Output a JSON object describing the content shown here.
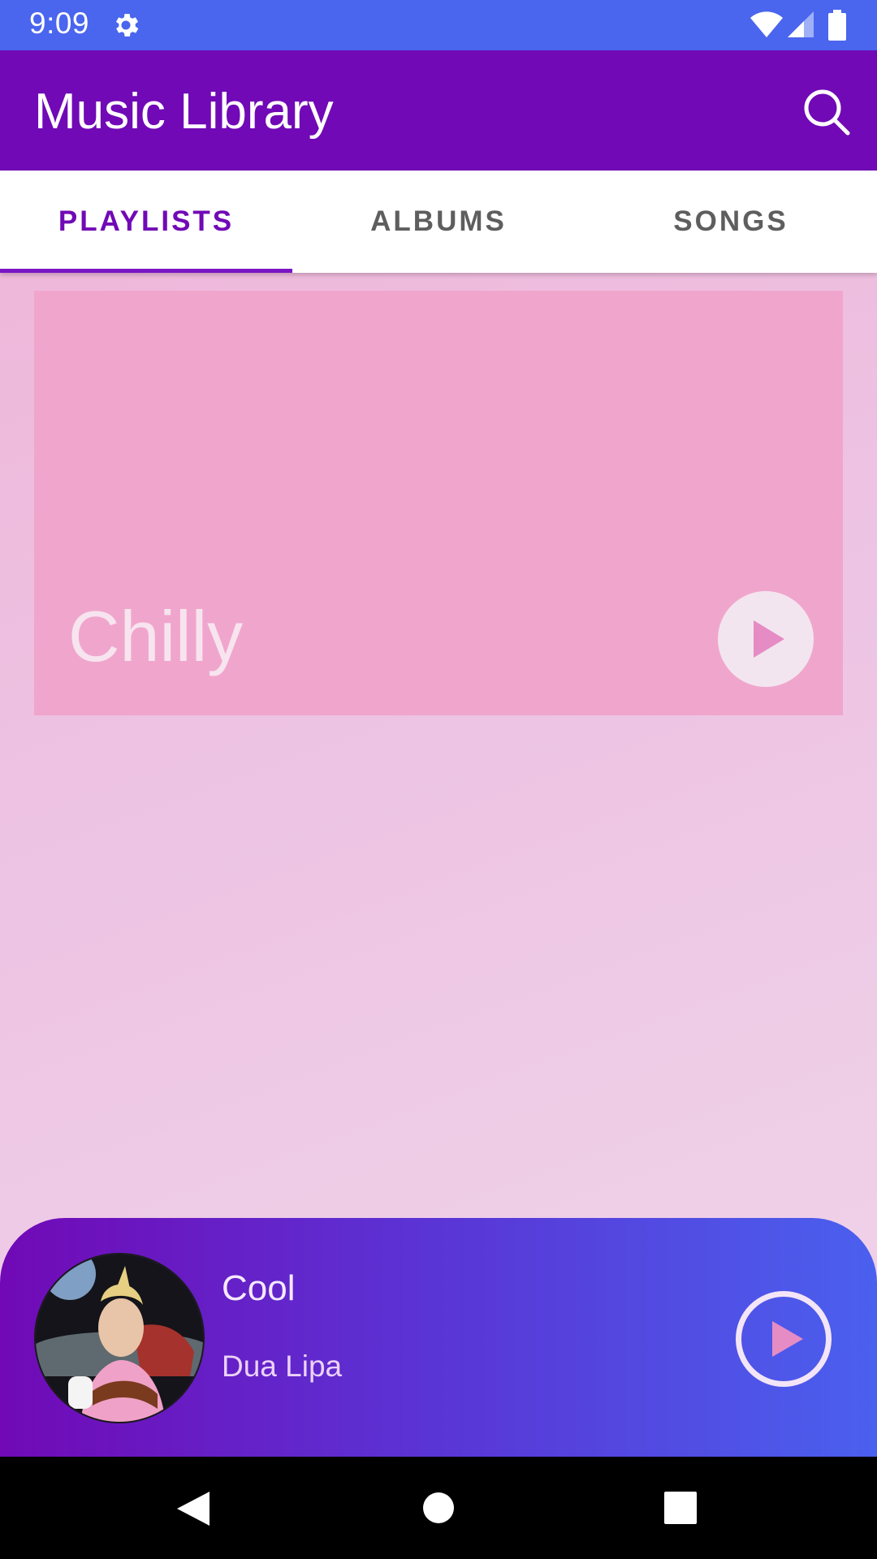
{
  "status_bar": {
    "time": "9:09",
    "icons": [
      "gear-icon",
      "wifi-icon",
      "signal-icon",
      "battery-icon"
    ]
  },
  "app_bar": {
    "title": "Music Library",
    "search_icon": "search-icon"
  },
  "tabs": [
    {
      "label": "PLAYLISTS",
      "active": true
    },
    {
      "label": "ALBUMS",
      "active": false
    },
    {
      "label": "SONGS",
      "active": false
    }
  ],
  "playlists": [
    {
      "name": "Chilly",
      "play_icon": "play-icon"
    }
  ],
  "now_playing": {
    "title": "Cool",
    "artist": "Dua Lipa",
    "play_icon": "play-icon"
  },
  "nav_bar": {
    "icons": [
      "back-icon",
      "home-icon",
      "recents-icon"
    ]
  },
  "colors": {
    "status_bar": "#4a65ee",
    "app_bar": "#7109b6",
    "accent": "#7109b6",
    "card": "#f0a6cc",
    "player_gradient_start": "#7109b6",
    "player_gradient_end": "#4a60ee",
    "play_triangle": "#e58cc4"
  }
}
